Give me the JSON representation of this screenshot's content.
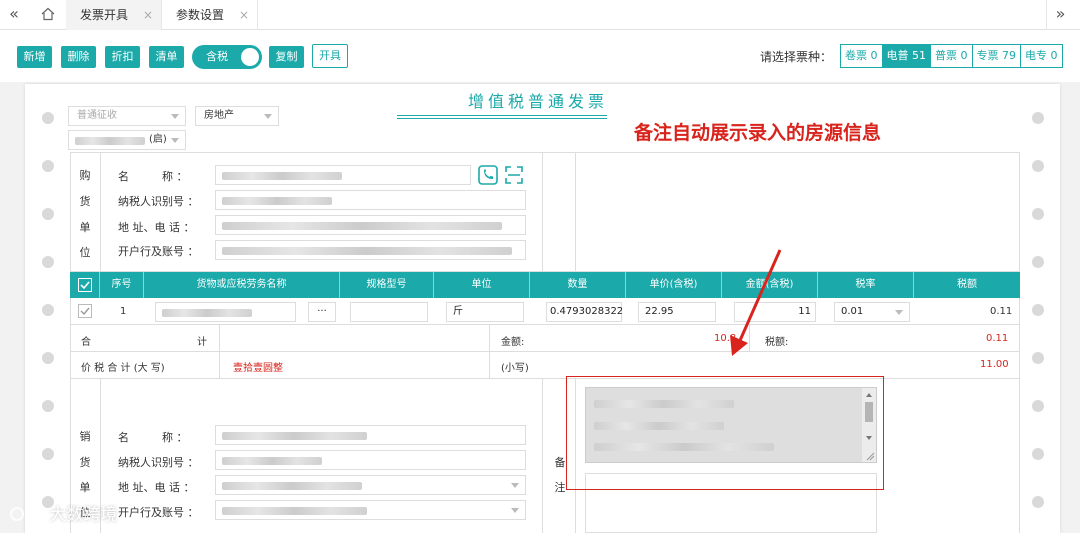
{
  "tabs": {
    "nav_left": "«",
    "nav_right": "»",
    "home_icon": "home-icon",
    "items": [
      {
        "label": "发票开具",
        "close": "×"
      },
      {
        "label": "参数设置",
        "close": "×"
      }
    ]
  },
  "toolbar": {
    "buttons": [
      "新增",
      "删除",
      "折扣",
      "清单"
    ],
    "toggle_label": "含税",
    "copy": "复制",
    "issue": "开具",
    "ticket_type_label": "请选择票种：",
    "ticket_types": [
      {
        "label": "卷票 0",
        "active": false
      },
      {
        "label": "电普 51",
        "active": true
      },
      {
        "label": "普票 0",
        "active": false
      },
      {
        "label": "专票 79",
        "active": false
      },
      {
        "label": "电专 0",
        "active": false
      }
    ]
  },
  "invoice": {
    "title": "增值税普通发票",
    "levy_select": "普通征收",
    "category_select": "房地产",
    "company_select_suffix": "(启)",
    "buyer": {
      "side_chars": [
        "购",
        "货",
        "单",
        "位"
      ],
      "labels": [
        "名　　　称 ：",
        "纳税人识别号 ：",
        "地 址、电 话 ：",
        "开户行及账号 ："
      ]
    },
    "table": {
      "headers": [
        "序号",
        "货物或应税劳务名称",
        "规格型号",
        "单位",
        "数量",
        "单价(含税)",
        "金额(含税)",
        "税率",
        "税额"
      ],
      "row": {
        "index": "1",
        "more": "···",
        "unit": "斤",
        "quantity": "0.4793028322",
        "price": "22.95",
        "amount": "11",
        "tax_rate": "0.01",
        "tax": "0.11"
      }
    },
    "totals": {
      "label_he": "合",
      "label_ji": "计",
      "amount_label": "金额:",
      "amount_value": "10.8",
      "tax_label": "税额:",
      "tax_value": "0.11",
      "capital_label": "价 税 合 计 (大 写)",
      "capital_value": "壹拾壹圆整",
      "small_label": "(小写)",
      "small_value": "11.00"
    },
    "seller": {
      "side_chars": [
        "销",
        "货",
        "单",
        "位"
      ],
      "labels": [
        "名　　　称 ：",
        "纳税人识别号 ：",
        "地 址、电 话 ：",
        "开户行及账号 ："
      ]
    },
    "remark": {
      "chars": [
        "备",
        "注"
      ]
    }
  },
  "annotation": "备注自动展示录入的房源信息",
  "watermark": "大数跨境",
  "colors": {
    "accent": "#1ba9a9",
    "red": "#d8241c"
  }
}
